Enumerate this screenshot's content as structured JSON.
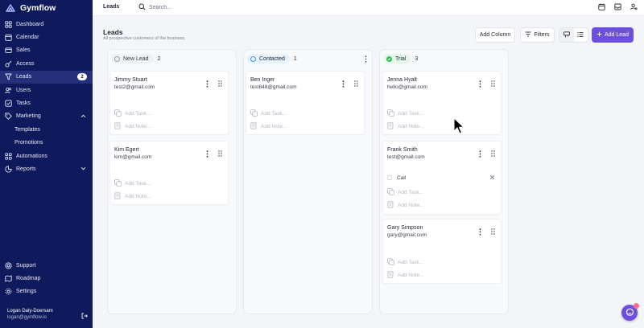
{
  "brand": {
    "name": "Gymflow"
  },
  "sidebar": {
    "items": [
      {
        "label": "Dashboard",
        "icon": "dashboard-icon"
      },
      {
        "label": "Calendar",
        "icon": "calendar-icon"
      },
      {
        "label": "Sales",
        "icon": "sales-icon"
      },
      {
        "label": "Access",
        "icon": "key-icon"
      },
      {
        "label": "Leads",
        "icon": "funnel-icon",
        "badge": "2",
        "active": true
      },
      {
        "label": "Users",
        "icon": "users-icon"
      },
      {
        "label": "Tasks",
        "icon": "tasks-icon"
      },
      {
        "label": "Marketing",
        "icon": "tag-icon",
        "expanded": true
      },
      {
        "label": "Templates",
        "sub": true
      },
      {
        "label": "Promotions",
        "sub": true
      },
      {
        "label": "Automations",
        "icon": "automation-icon"
      },
      {
        "label": "Reports",
        "icon": "reports-icon",
        "expanded": false
      }
    ],
    "bottom": [
      {
        "label": "Support",
        "icon": "support-icon"
      },
      {
        "label": "Roadmap",
        "icon": "roadmap-icon"
      },
      {
        "label": "Settings",
        "icon": "gear-icon"
      }
    ],
    "user": {
      "name": "Logan Daly-Doersam",
      "email": "logan@gymflow.io"
    }
  },
  "topbar": {
    "title": "Leads",
    "search_placeholder": "Search..."
  },
  "page": {
    "title": "Leads",
    "subtitle": "All prospective customers of the business."
  },
  "toolbar": {
    "add_column": "Add Column",
    "filters": "Filters",
    "add_lead": "Add Lead"
  },
  "columns": [
    {
      "name": "New Lead",
      "count": "2",
      "color": "#9aa0ac",
      "cards": [
        {
          "name": "Jimmy Stuart",
          "email": "test2@gmail.com",
          "add_task": "Add Task...",
          "add_note": "Add Note..."
        },
        {
          "name": "Kim Egert",
          "email": "kim@gmail.com",
          "add_task": "Add Task...",
          "add_note": "Add Note..."
        }
      ]
    },
    {
      "name": "Contacted",
      "count": "1",
      "color": "#3a9be0",
      "cards": [
        {
          "name": "Ben Inger",
          "email": "test848@gmail.com",
          "add_task": "Add Task...",
          "add_note": "Add Note..."
        }
      ]
    },
    {
      "name": "Trial",
      "count": "3",
      "color": "#2fbf5b",
      "cards": [
        {
          "name": "Jenna Hyalt",
          "email": "hello@gmail.com",
          "add_task": "Add Task...",
          "add_note": "Add Note..."
        },
        {
          "name": "Frank Smith",
          "email": "test@gmail.com",
          "task": "Call",
          "add_task": "Add Task...",
          "add_note": "Add Note..."
        },
        {
          "name": "Gary Simpson",
          "email": "gary@gmail.com",
          "add_task": "Add Task...",
          "add_note": "Add Note..."
        }
      ]
    }
  ],
  "colors": {
    "sidebar": "#0f1a5c",
    "accent": "#6d4fe0",
    "active_item": "#24307a"
  }
}
